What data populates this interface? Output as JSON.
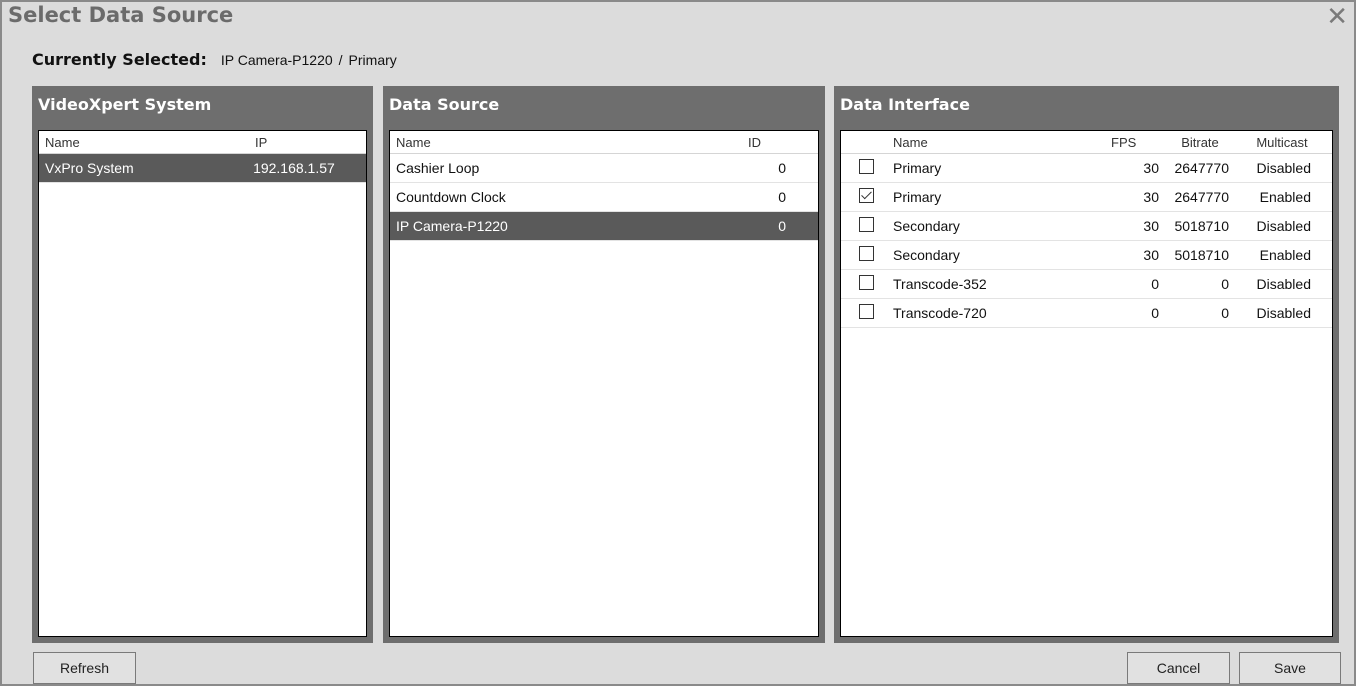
{
  "window": {
    "title": "Select Data Source",
    "close_glyph": "✕",
    "close_icon": "close-icon"
  },
  "currently_selected": {
    "label": "Currently Selected:",
    "source": "IP Camera-P1220",
    "separator": "/",
    "interface": "Primary"
  },
  "systems_panel": {
    "title": "VideoXpert System",
    "columns": [
      "Name",
      "IP"
    ],
    "rows": [
      {
        "name": "VxPro System",
        "ip": "192.168.1.57",
        "selected": true
      }
    ]
  },
  "source_panel": {
    "title": "Data Source",
    "columns": [
      "Name",
      "ID"
    ],
    "rows": [
      {
        "name": "Cashier Loop",
        "id": "0",
        "selected": false
      },
      {
        "name": "Countdown Clock",
        "id": "0",
        "selected": false
      },
      {
        "name": "IP Camera-P1220",
        "id": "0",
        "selected": true
      }
    ]
  },
  "interface_panel": {
    "title": "Data Interface",
    "columns": [
      "",
      "Name",
      "FPS",
      "Bitrate",
      "Multicast"
    ],
    "rows": [
      {
        "checked": false,
        "name": "Primary",
        "fps": "30",
        "bitrate": "2647770",
        "multicast": "Disabled"
      },
      {
        "checked": true,
        "name": "Primary",
        "fps": "30",
        "bitrate": "2647770",
        "multicast": "Enabled"
      },
      {
        "checked": false,
        "name": "Secondary",
        "fps": "30",
        "bitrate": "5018710",
        "multicast": "Disabled"
      },
      {
        "checked": false,
        "name": "Secondary",
        "fps": "30",
        "bitrate": "5018710",
        "multicast": "Enabled"
      },
      {
        "checked": false,
        "name": "Transcode-352",
        "fps": "0",
        "bitrate": "0",
        "multicast": "Disabled"
      },
      {
        "checked": false,
        "name": "Transcode-720",
        "fps": "0",
        "bitrate": "0",
        "multicast": "Disabled"
      }
    ]
  },
  "buttons": {
    "refresh": "Refresh",
    "cancel": "Cancel",
    "save": "Save"
  },
  "colors": {
    "panel_bg": "#6e6e6e",
    "selected_row": "#5a5a5a",
    "dialog_bg": "#dcdcdc"
  }
}
